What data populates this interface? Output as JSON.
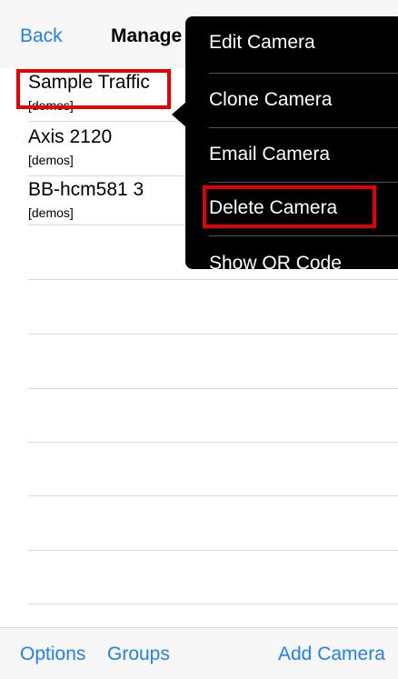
{
  "navbar": {
    "back_label": "Back",
    "title": "Manage Cameras"
  },
  "cameras": [
    {
      "name": "Sample Traffic",
      "group": "[demos]"
    },
    {
      "name": "Axis 2120",
      "group": "[demos]"
    },
    {
      "name": "BB-hcm581 3",
      "group": "[demos]"
    }
  ],
  "menu": {
    "items": [
      "Edit Camera",
      "Clone Camera",
      "Email Camera",
      "Delete Camera",
      "Show QR Code"
    ]
  },
  "toolbar": {
    "options_label": "Options",
    "groups_label": "Groups",
    "add_camera_label": "Add Camera"
  },
  "colors": {
    "accent": "#1f7ff7",
    "highlight": "#e50000",
    "menu_background": "#000000"
  }
}
